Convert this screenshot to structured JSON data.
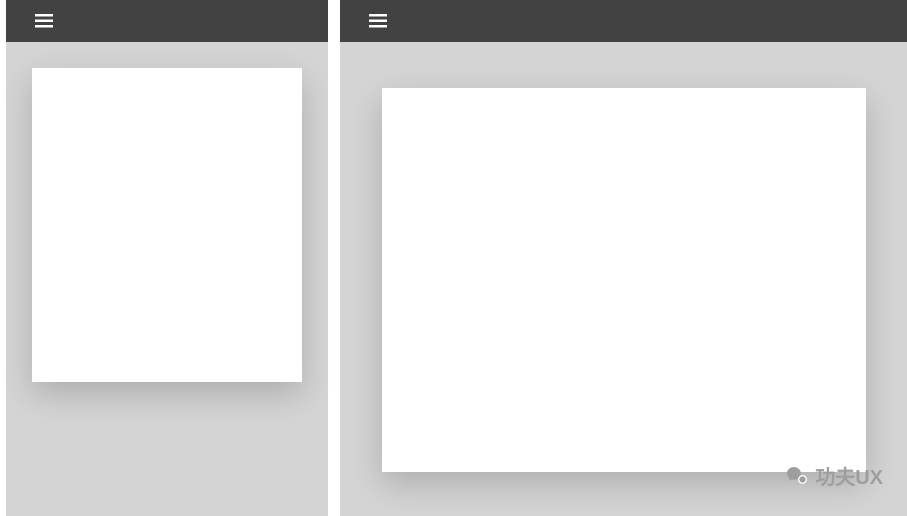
{
  "watermark": {
    "text": "功夫UX"
  },
  "icons": {
    "menu": "menu-icon",
    "watermark_bubble": "chat-bubble-icon"
  },
  "colors": {
    "header_bg": "#424242",
    "panel_bg": "#d4d4d4",
    "card_bg": "#ffffff",
    "watermark_fg": "#9e9e9e"
  },
  "panels": [
    {
      "id": "left",
      "card": true
    },
    {
      "id": "right",
      "card": true
    }
  ]
}
